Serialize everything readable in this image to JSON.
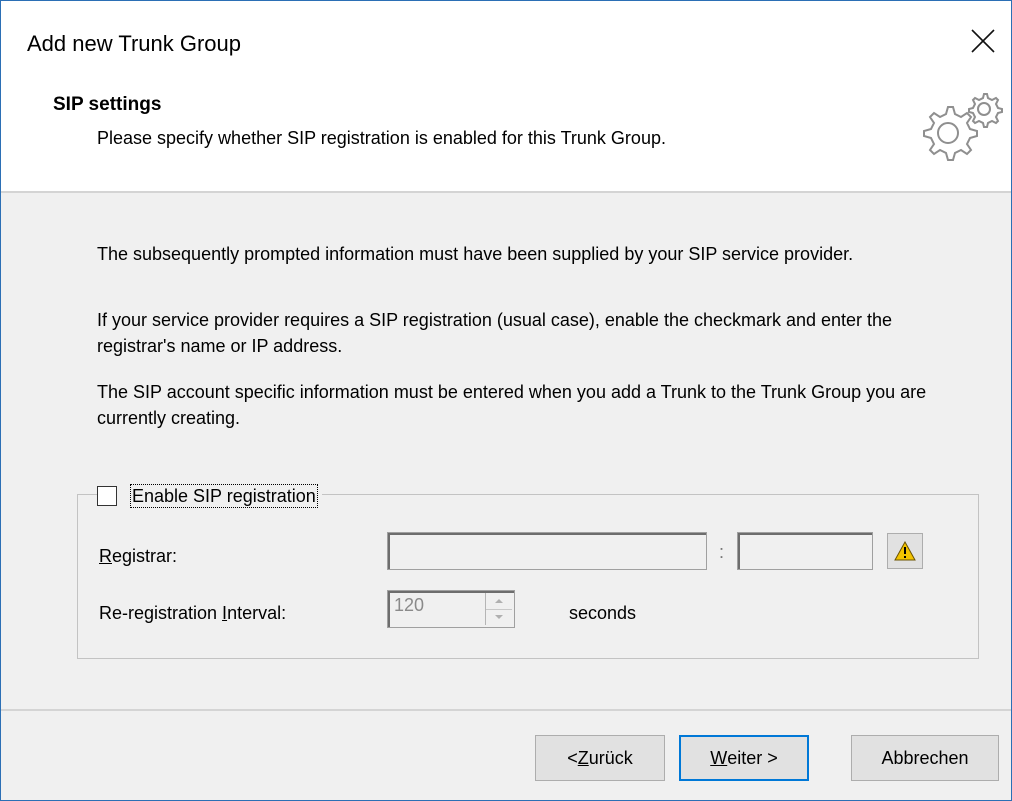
{
  "window": {
    "title": "Add new Trunk Group"
  },
  "header": {
    "heading": "SIP settings",
    "subheading": "Please specify whether SIP registration is enabled for this Trunk Group.",
    "icon": "gears-icon"
  },
  "body": {
    "para1": "The subsequently prompted information must have been supplied by your SIP service provider.",
    "para2": "If your service provider requires a SIP registration (usual case), enable the checkmark and enter the registrar's name or IP address.",
    "para3": "The SIP account specific information must be entered when you add a Trunk to the Trunk Group you are currently creating."
  },
  "sip_group": {
    "enable_label": "Enable SIP registration",
    "enable_checked": false,
    "registrar": {
      "label_mnemonic": "R",
      "label_rest": "egistrar:",
      "host_value": "",
      "port_value": "",
      "separator": ":",
      "warning_icon": "warning-icon"
    },
    "reregistration": {
      "label_pre": "Re-registration ",
      "label_mnemonic": "I",
      "label_rest": "nterval:",
      "value": "120",
      "unit": "seconds"
    }
  },
  "footer": {
    "back": {
      "pre": "< ",
      "mnemonic": "Z",
      "rest": "urück"
    },
    "next": {
      "mnemonic": "W",
      "rest": "eiter >"
    },
    "cancel": "Abbrechen"
  }
}
